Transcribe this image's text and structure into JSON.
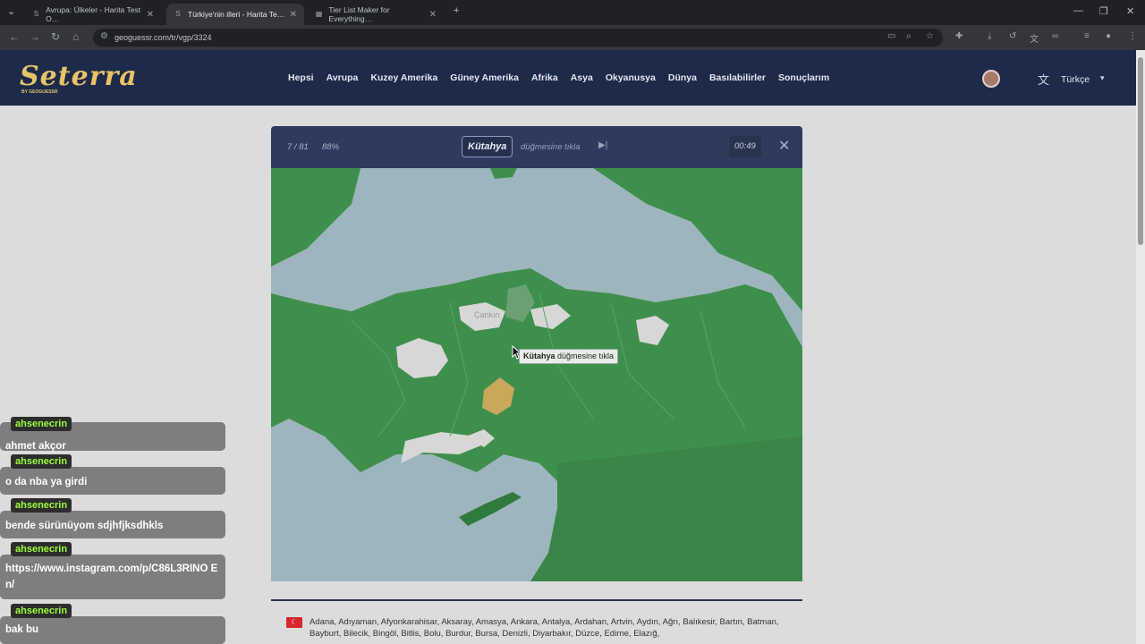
{
  "browser": {
    "tabs": [
      {
        "title": "Avrupa: Ülkeler - Harita Test O…"
      },
      {
        "title": "Türkiye'nin illeri - Harita Te…"
      },
      {
        "title": "Tier List Maker for Everything…"
      }
    ],
    "url": "geoguessr.com/tr/vgp/3324"
  },
  "header": {
    "logo": "Seterra",
    "logo_sub": "BY GEOGUESSR",
    "menu": [
      "Hepsi",
      "Avrupa",
      "Kuzey Amerika",
      "Güney Amerika",
      "Afrika",
      "Asya",
      "Okyanusya",
      "Dünya",
      "Basılabilirler",
      "Sonuçlarım"
    ],
    "language": "Türkçe"
  },
  "game": {
    "counter": "7 / 81",
    "percent": "88%",
    "target": "Kütahya",
    "instruction": "düğmesine tıkla",
    "timer": "00:49",
    "tooltip_target": "Kütahya",
    "tooltip_text": "düğmesine tıkla",
    "map_label": "Çankırı",
    "provinces": "Adana, Adıyaman, Afyonkarahisar, Aksaray, Amasya, Ankara, Antalya, Ardahan, Artvin, Aydın, Ağrı, Balıkesir, Bartın, Batman, Bayburt, Bilecik, Bingöl, Bitlis, Bolu, Burdur, Bursa, Denizli, Diyarbakır, Düzce, Edirne, Elazığ,",
    "colors": {
      "land": "#3f8f4c",
      "sea": "#9eb5bd",
      "done": "#d7d7d7",
      "highlight": "#c9a85c"
    }
  },
  "chat": [
    {
      "user": "ahsenecrin",
      "text": "ahmet akçor"
    },
    {
      "user": "ahsenecrin",
      "text": "o da nba ya girdi"
    },
    {
      "user": "ahsenecrin",
      "text": "bende sürünüyom sdjhfjksdhkls"
    },
    {
      "user": "ahsenecrin",
      "text": "https://www.instagram.com/p/C86L3RINO En/"
    },
    {
      "user": "ahsenecrin",
      "text": "bak bu"
    }
  ]
}
